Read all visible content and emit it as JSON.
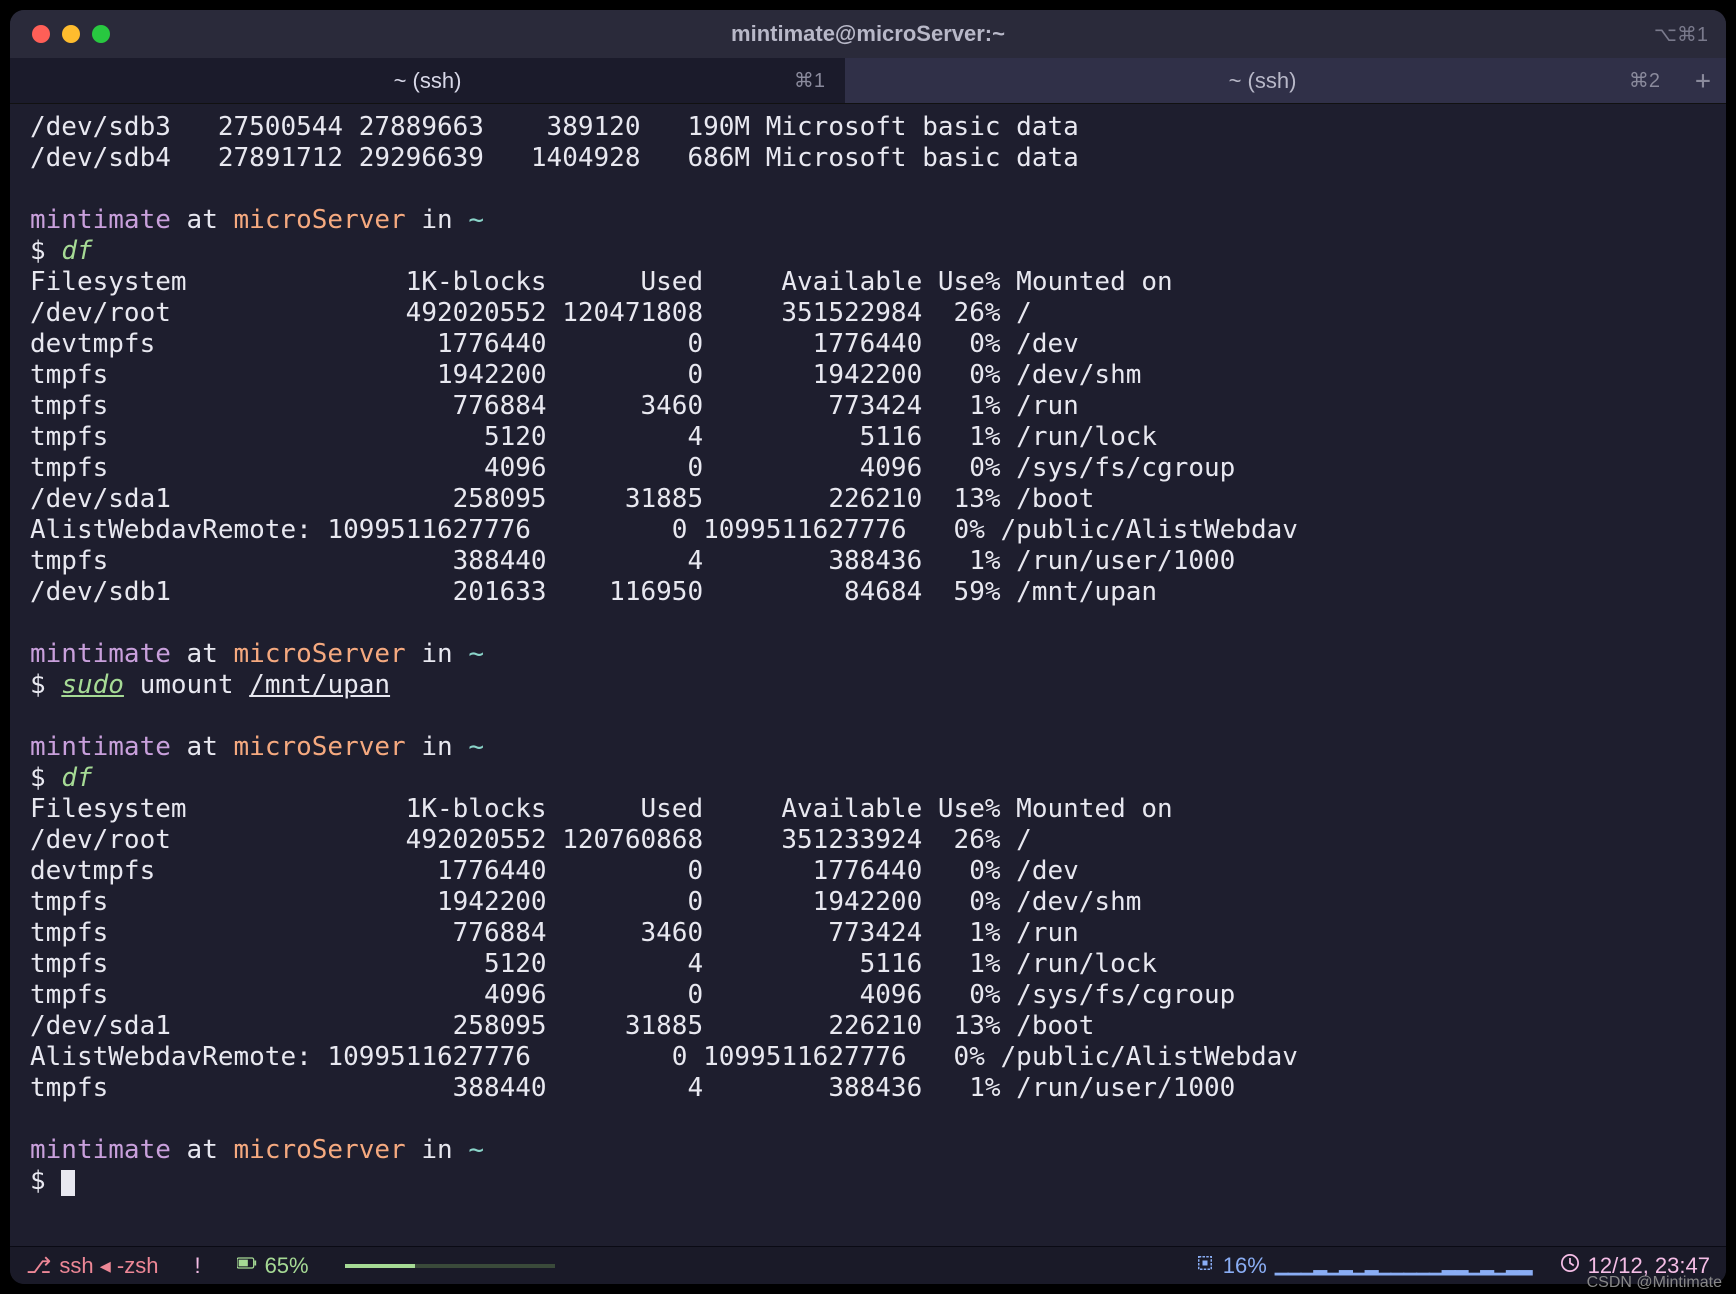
{
  "window": {
    "title": "mintimate@microServer:~",
    "toolbar_hint": "⌥⌘1"
  },
  "tabs": [
    {
      "label": "~ (ssh)",
      "shortcut": "⌘1",
      "active": true
    },
    {
      "label": "~ (ssh)",
      "shortcut": "⌘2",
      "active": false
    }
  ],
  "prompt": {
    "user": "mintimate",
    "at": " at ",
    "host": "microServer",
    "in": " in ",
    "path": "~",
    "sigil": "$ "
  },
  "top_lines": [
    "/dev/sdb3   27500544 27889663    389120   190M Microsoft basic data",
    "/dev/sdb4   27891712 29296639   1404928   686M Microsoft basic data"
  ],
  "commands": {
    "df1": "df",
    "umount_sudo": "sudo",
    "umount_rest": " umount ",
    "umount_arg": "/mnt/upan",
    "df2": "df"
  },
  "df_header": "Filesystem              1K-blocks      Used     Available Use% Mounted on",
  "df1_rows": [
    "/dev/root               492020552 120471808     351522984  26% /",
    "devtmpfs                  1776440         0       1776440   0% /dev",
    "tmpfs                     1942200         0       1942200   0% /dev/shm",
    "tmpfs                      776884      3460        773424   1% /run",
    "tmpfs                        5120         4          5116   1% /run/lock",
    "tmpfs                        4096         0          4096   0% /sys/fs/cgroup",
    "/dev/sda1                  258095     31885        226210  13% /boot",
    "AlistWebdavRemote: 1099511627776         0 1099511627776   0% /public/AlistWebdav",
    "tmpfs                      388440         4        388436   1% /run/user/1000",
    "/dev/sdb1                  201633    116950         84684  59% /mnt/upan"
  ],
  "df2_rows": [
    "/dev/root               492020552 120760868     351233924  26% /",
    "devtmpfs                  1776440         0       1776440   0% /dev",
    "tmpfs                     1942200         0       1942200   0% /dev/shm",
    "tmpfs                      776884      3460        773424   1% /run",
    "tmpfs                        5120         4          5116   1% /run/lock",
    "tmpfs                        4096         0          4096   0% /sys/fs/cgroup",
    "/dev/sda1                  258095     31885        226210  13% /boot",
    "AlistWebdavRemote: 1099511627776         0 1099511627776   0% /public/AlistWebdav",
    "tmpfs                      388440         4        388436   1% /run/user/1000"
  ],
  "status": {
    "process": "ssh ◂ -zsh",
    "git": "!",
    "battery": "65%",
    "cpu": "16%",
    "clock": "12/12, 23:47"
  },
  "watermark": "CSDN @Mintimate"
}
